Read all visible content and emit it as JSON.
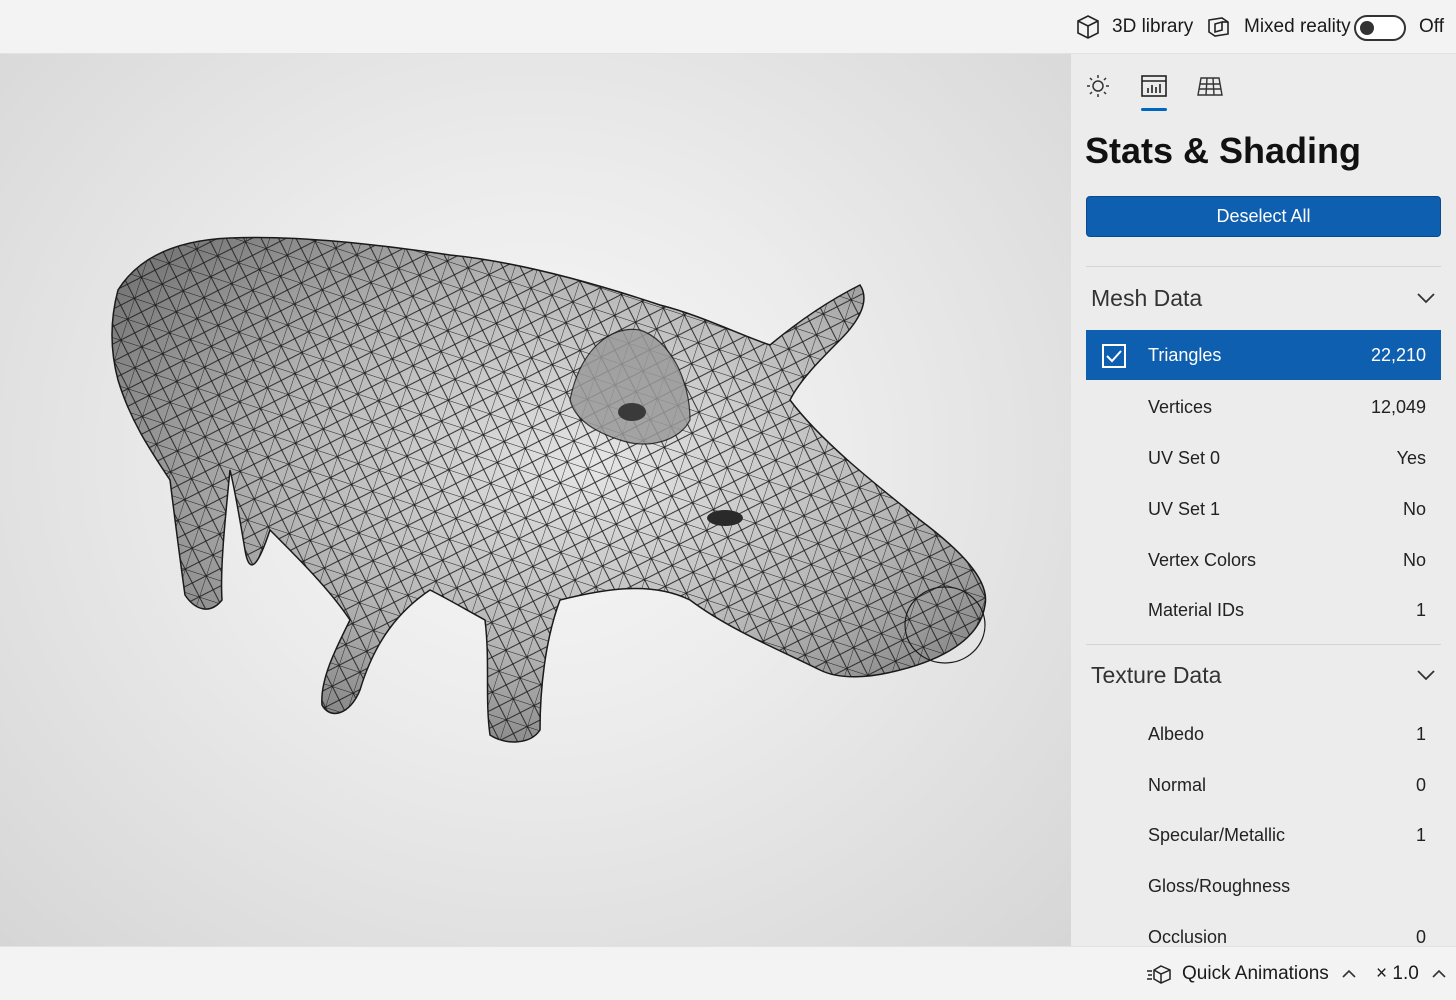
{
  "topbar": {
    "library_label": "3D library",
    "library_icon": "cube-icon",
    "mixed_reality_label": "Mixed reality",
    "mixed_reality_icon": "mixed-reality-icon",
    "toggle_state": "Off"
  },
  "viewport": {
    "model": "pig-wireframe"
  },
  "panel": {
    "tabs": [
      {
        "icon": "lighting-icon"
      },
      {
        "icon": "stats-icon",
        "active": true
      },
      {
        "icon": "grid-icon"
      }
    ],
    "title": "Stats & Shading",
    "deselect_label": "Deselect All",
    "mesh_section": {
      "title": "Mesh Data",
      "rows": [
        {
          "label": "Triangles",
          "value": "22,210",
          "selected": true
        },
        {
          "label": "Vertices",
          "value": "12,049"
        },
        {
          "label": "UV Set 0",
          "value": "Yes"
        },
        {
          "label": "UV Set 1",
          "value": "No"
        },
        {
          "label": "Vertex Colors",
          "value": "No"
        },
        {
          "label": "Material IDs",
          "value": "1"
        }
      ]
    },
    "texture_section": {
      "title": "Texture Data",
      "rows": [
        {
          "label": "Albedo",
          "value": "1"
        },
        {
          "label": "Normal",
          "value": "0"
        },
        {
          "label": "Specular/Metallic",
          "value": "1"
        },
        {
          "label": "Gloss/Roughness",
          "value": ""
        },
        {
          "label": "Occlusion",
          "value": "0"
        }
      ]
    }
  },
  "bottombar": {
    "quick_animations_label": "Quick Animations",
    "speed_label": "× 1.0"
  },
  "colors": {
    "accent": "#0f5fb0",
    "background": "#f3f3f3",
    "panel": "#ececec"
  }
}
